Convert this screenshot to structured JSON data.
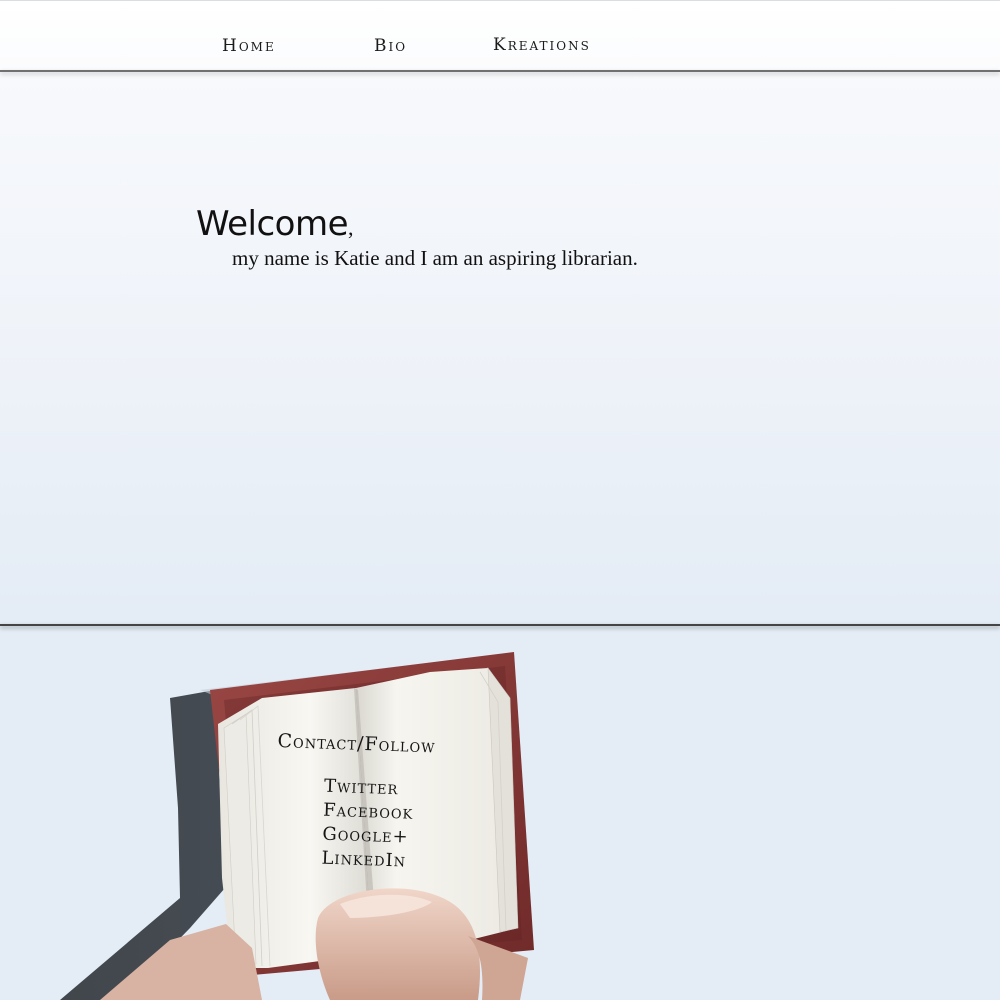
{
  "nav": {
    "items": [
      {
        "label": "Home"
      },
      {
        "label": "Bio"
      },
      {
        "label": "Kreations"
      }
    ]
  },
  "hero": {
    "title": "Welcome",
    "title_punct": ",",
    "subtitle": "my name is Katie and I am an aspiring librarian."
  },
  "contact": {
    "heading": "Contact/Follow",
    "links": [
      {
        "label": "Twitter"
      },
      {
        "label": "Facebook"
      },
      {
        "label": "Google+"
      },
      {
        "label": "LinkedIn"
      }
    ]
  },
  "colors": {
    "background": "#e4ecf5",
    "book_cover": "#8a3a38",
    "page": "#f7f5ef",
    "shadow": "#3a3f45",
    "text": "#111111"
  },
  "icons": {
    "book": "open-book-illustration"
  }
}
